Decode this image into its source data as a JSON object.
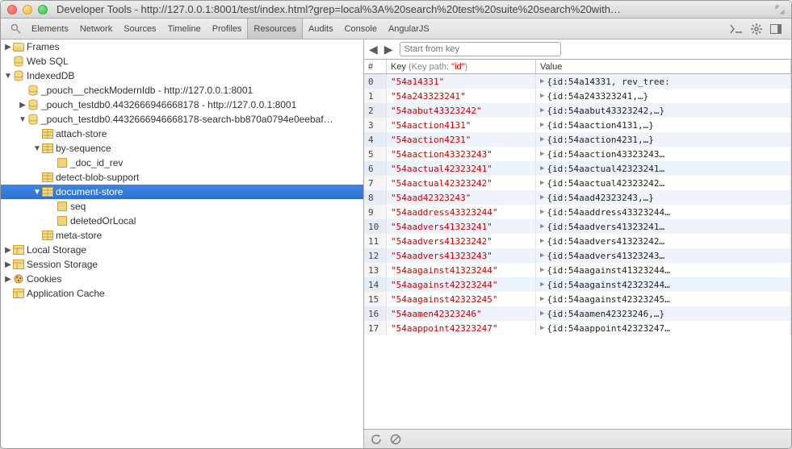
{
  "window": {
    "title": "Developer Tools - http://127.0.0.1:8001/test/index.html?grep=local%3A%20search%20test%20suite%20search%20with…"
  },
  "tabs": [
    {
      "label": "Elements"
    },
    {
      "label": "Network"
    },
    {
      "label": "Sources"
    },
    {
      "label": "Timeline"
    },
    {
      "label": "Profiles"
    },
    {
      "label": "Resources",
      "active": true
    },
    {
      "label": "Audits"
    },
    {
      "label": "Console"
    },
    {
      "label": "AngularJS"
    }
  ],
  "filter_placeholder": "Start from key",
  "tree": {
    "items": [
      {
        "type": "folder",
        "arrow": "▶",
        "label": "Frames",
        "indent": 0,
        "icon": "folder"
      },
      {
        "type": "group",
        "arrow": "",
        "label": "Web SQL",
        "indent": 0,
        "icon": "db"
      },
      {
        "type": "group",
        "arrow": "▼",
        "label": "IndexedDB",
        "indent": 0,
        "icon": "db"
      },
      {
        "type": "db",
        "arrow": "",
        "label": "_pouch__checkModernIdb - http://127.0.0.1:8001",
        "indent": 1,
        "icon": "db"
      },
      {
        "type": "db",
        "arrow": "▶",
        "label": "_pouch_testdb0.4432666946668178 - http://127.0.0.1:8001",
        "indent": 1,
        "icon": "db"
      },
      {
        "type": "db",
        "arrow": "▼",
        "label": "_pouch_testdb0.4432666946668178-search-bb870a0794e0eebaf…",
        "indent": 1,
        "icon": "db"
      },
      {
        "type": "table",
        "arrow": "",
        "label": "attach-store",
        "indent": 2,
        "icon": "table"
      },
      {
        "type": "table",
        "arrow": "▼",
        "label": "by-sequence",
        "indent": 2,
        "icon": "table"
      },
      {
        "type": "col",
        "arrow": "",
        "label": "_doc_id_rev",
        "indent": 3,
        "icon": "col"
      },
      {
        "type": "table",
        "arrow": "",
        "label": "detect-blob-support",
        "indent": 2,
        "icon": "table"
      },
      {
        "type": "table",
        "arrow": "▼",
        "label": "document-store",
        "indent": 2,
        "icon": "table",
        "selected": true
      },
      {
        "type": "col",
        "arrow": "",
        "label": "seq",
        "indent": 3,
        "icon": "col"
      },
      {
        "type": "col",
        "arrow": "",
        "label": "deletedOrLocal",
        "indent": 3,
        "icon": "col"
      },
      {
        "type": "table",
        "arrow": "",
        "label": "meta-store",
        "indent": 2,
        "icon": "table"
      },
      {
        "type": "group",
        "arrow": "▶",
        "label": "Local Storage",
        "indent": 0,
        "icon": "box"
      },
      {
        "type": "group",
        "arrow": "▶",
        "label": "Session Storage",
        "indent": 0,
        "icon": "box"
      },
      {
        "type": "group",
        "arrow": "▶",
        "label": "Cookies",
        "indent": 0,
        "icon": "cookie"
      },
      {
        "type": "group",
        "arrow": "",
        "label": "Application Cache",
        "indent": 0,
        "icon": "box"
      }
    ]
  },
  "grid": {
    "headers": {
      "index": "#",
      "key": "Key",
      "keypath_label": "(Key path: ",
      "keypath_id": "\"id\"",
      "keypath_close": ")",
      "value": "Value"
    },
    "rows": [
      {
        "i": 0,
        "key": "\"54a14331\"",
        "val": "{id:54a14331, rev_tree:"
      },
      {
        "i": 1,
        "key": "\"54a243323241\"",
        "val": "{id:54a243323241,…}"
      },
      {
        "i": 2,
        "key": "\"54aabut43323242\"",
        "val": "{id:54aabut43323242,…}"
      },
      {
        "i": 3,
        "key": "\"54aaction4131\"",
        "val": "{id:54aaction4131,…}"
      },
      {
        "i": 4,
        "key": "\"54aaction4231\"",
        "val": "{id:54aaction4231,…}"
      },
      {
        "i": 5,
        "key": "\"54aaction43323243\"",
        "val": "{id:54aaction43323243…"
      },
      {
        "i": 6,
        "key": "\"54aactual42323241\"",
        "val": "{id:54aactual42323241…"
      },
      {
        "i": 7,
        "key": "\"54aactual42323242\"",
        "val": "{id:54aactual42323242…"
      },
      {
        "i": 8,
        "key": "\"54aad42323243\"",
        "val": "{id:54aad42323243,…}"
      },
      {
        "i": 9,
        "key": "\"54aaddress43323244\"",
        "val": "{id:54aaddress43323244…"
      },
      {
        "i": 10,
        "key": "\"54aadvers41323241\"",
        "val": "{id:54aadvers41323241…"
      },
      {
        "i": 11,
        "key": "\"54aadvers41323242\"",
        "val": "{id:54aadvers41323242…"
      },
      {
        "i": 12,
        "key": "\"54aadvers41323243\"",
        "val": "{id:54aadvers41323243…"
      },
      {
        "i": 13,
        "key": "\"54aagainst41323244\"",
        "val": "{id:54aagainst41323244…"
      },
      {
        "i": 14,
        "key": "\"54aagainst42323244\"",
        "val": "{id:54aagainst42323244…"
      },
      {
        "i": 15,
        "key": "\"54aagainst42323245\"",
        "val": "{id:54aagainst42323245…"
      },
      {
        "i": 16,
        "key": "\"54aamen42323246\"",
        "val": "{id:54aamen42323246,…}"
      },
      {
        "i": 17,
        "key": "\"54aappoint42323247\"",
        "val": "{id:54aappoint42323247…"
      }
    ]
  }
}
